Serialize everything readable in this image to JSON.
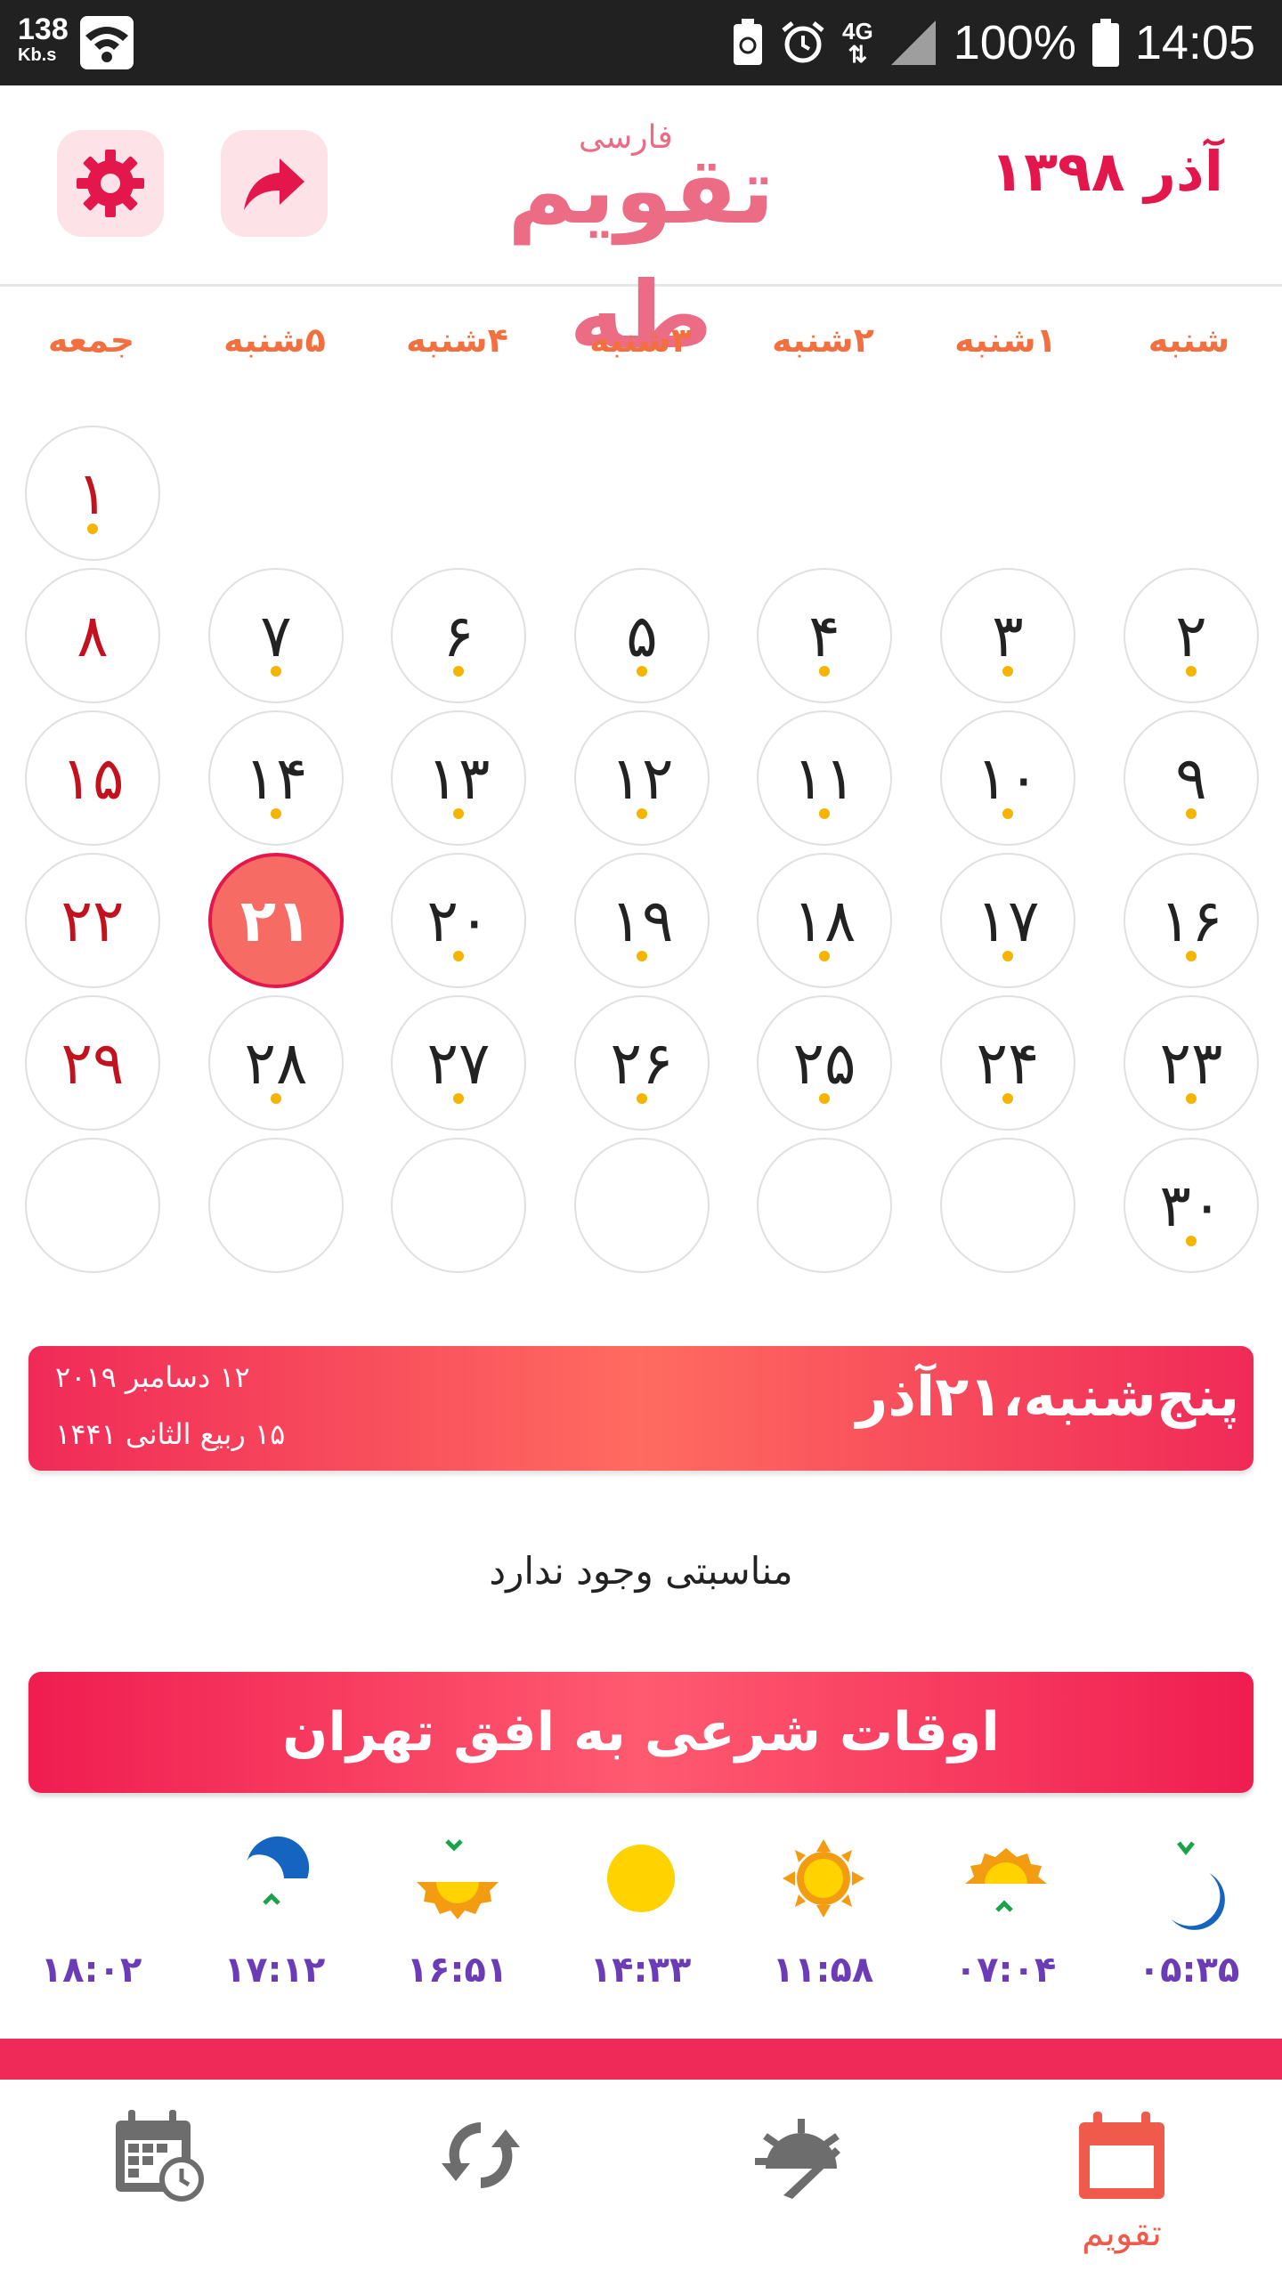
{
  "status_bar": {
    "speed_value": "138",
    "speed_unit": "Kb.s",
    "network": "4G",
    "battery": "100%",
    "time": "14:05"
  },
  "header": {
    "month_year": "آذر ۱۳۹۸",
    "logo_main": "تقویم طه",
    "logo_sub": "فارسی"
  },
  "weekdays": [
    "شنبه",
    "۱شنبه",
    "۲شنبه",
    "۳شنبه",
    "۴شنبه",
    "۵شنبه",
    "جمعه"
  ],
  "calendar": {
    "today": "۲۱",
    "rows": [
      [
        "",
        "",
        "",
        "",
        "",
        "",
        "۱"
      ],
      [
        "۲",
        "۳",
        "۴",
        "۵",
        "۶",
        "۷",
        "۸"
      ],
      [
        "۹",
        "۱۰",
        "۱۱",
        "۱۲",
        "۱۳",
        "۱۴",
        "۱۵"
      ],
      [
        "۱۶",
        "۱۷",
        "۱۸",
        "۱۹",
        "۲۰",
        "۲۱",
        "۲۲"
      ],
      [
        "۲۳",
        "۲۴",
        "۲۵",
        "۲۶",
        "۲۷",
        "۲۸",
        "۲۹"
      ],
      [
        "۳۰",
        "",
        "",
        "",
        "",
        "",
        ""
      ]
    ]
  },
  "date_banner": {
    "title": "پنج‌شنبه،۲۱آذر",
    "gregorian": "۱۲ دسامبر ۲۰۱۹",
    "hijri": "۱۵ ربیع الثانی ۱۴۴۱"
  },
  "occasion": "مناسبتی وجود ندارد",
  "prayer_banner": "اوقات شرعی به افق تهران",
  "prayer_times": [
    {
      "icon": "dawn-moon-icon",
      "time": "۰۵:۳۵"
    },
    {
      "icon": "sunrise-icon",
      "time": "۰۷:۰۴"
    },
    {
      "icon": "noon-sun-icon",
      "time": "۱۱:۵۸"
    },
    {
      "icon": "afternoon-sun-icon",
      "time": "۱۴:۳۳"
    },
    {
      "icon": "sunset-icon",
      "time": "۱۶:۵۱"
    },
    {
      "icon": "maghrib-moon-icon",
      "time": "۱۷:۱۲"
    },
    {
      "icon": "night-moon-icon",
      "time": "۱۸:۰۲"
    }
  ],
  "bottom_nav": {
    "calendar_label": "تقویم"
  },
  "colors": {
    "accent": "#f02a58",
    "friday": "#c3111e",
    "weekday_header": "#f2703f",
    "time_text": "#6b3cb6",
    "dot": "#f5b400"
  }
}
